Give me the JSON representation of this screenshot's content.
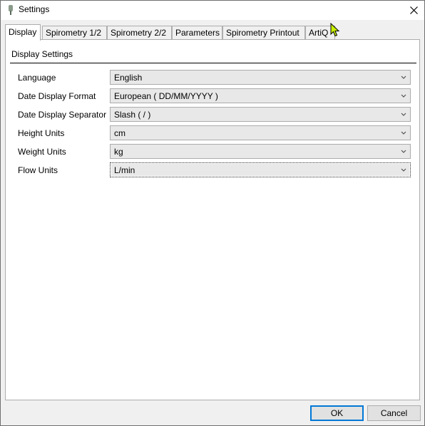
{
  "window": {
    "title": "Settings"
  },
  "tabs": [
    {
      "label": "Display",
      "active": true
    },
    {
      "label": "Spirometry 1/2",
      "active": false
    },
    {
      "label": "Spirometry 2/2",
      "active": false
    },
    {
      "label": "Parameters",
      "active": false
    },
    {
      "label": "Spirometry Printout",
      "active": false
    },
    {
      "label": "ArtiQ",
      "active": false
    }
  ],
  "display_settings": {
    "header": "Display Settings",
    "fields": [
      {
        "label": "Language",
        "value": "English"
      },
      {
        "label": "Date Display Format",
        "value": "European ( DD/MM/YYYY )"
      },
      {
        "label": "Date Display Separator",
        "value": "Slash ( / )"
      },
      {
        "label": "Height Units",
        "value": "cm"
      },
      {
        "label": "Weight Units",
        "value": "kg"
      },
      {
        "label": "Flow Units",
        "value": "L/min"
      }
    ]
  },
  "buttons": {
    "ok": "OK",
    "cancel": "Cancel"
  },
  "colors": {
    "accent": "#0078d7",
    "cursor": "#c8f000"
  },
  "icons": {
    "app": "app-icon",
    "close": "close-icon",
    "dropdown": "chevron-down-icon",
    "pointer": "mouse-pointer-icon"
  }
}
